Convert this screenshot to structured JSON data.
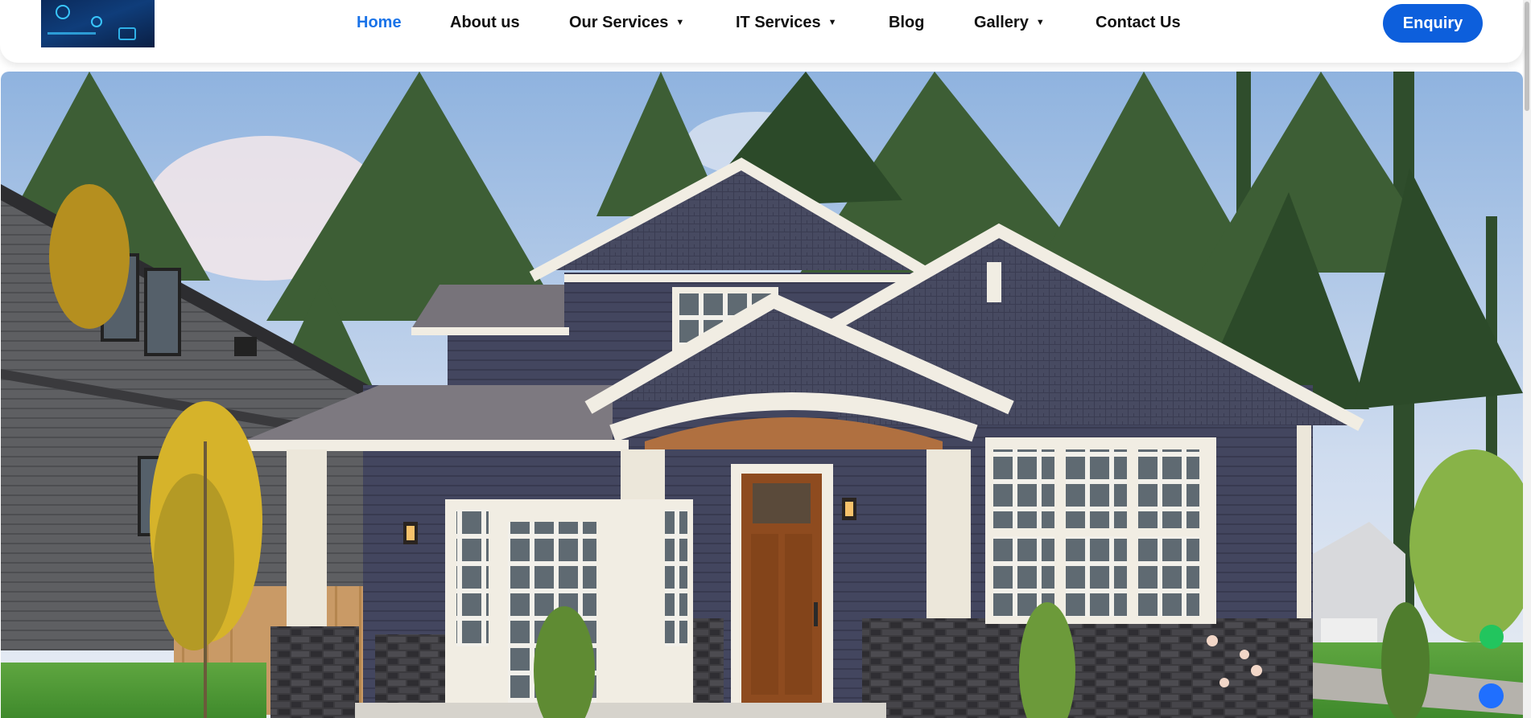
{
  "header": {
    "nav": [
      {
        "label": "Home",
        "active": true,
        "has_dropdown": false
      },
      {
        "label": "About us",
        "active": false,
        "has_dropdown": false
      },
      {
        "label": "Our Services",
        "active": false,
        "has_dropdown": true
      },
      {
        "label": "IT Services",
        "active": false,
        "has_dropdown": true
      },
      {
        "label": "Blog",
        "active": false,
        "has_dropdown": false
      },
      {
        "label": "Gallery",
        "active": false,
        "has_dropdown": true
      },
      {
        "label": "Contact Us",
        "active": false,
        "has_dropdown": false
      }
    ],
    "dropdown_glyph": "▼",
    "enquiry_label": "Enquiry"
  },
  "colors": {
    "active_nav": "#1a73e8",
    "button": "#0d5fdc",
    "float_green": "#22c55e",
    "float_blue": "#1f6fff"
  },
  "hero": {
    "image": "craftsman-house-with-navy-siding-and-white-trim-among-pine-trees"
  },
  "floating": {
    "green_icon": "whatsapp-icon",
    "blue_icon": "call-icon"
  }
}
